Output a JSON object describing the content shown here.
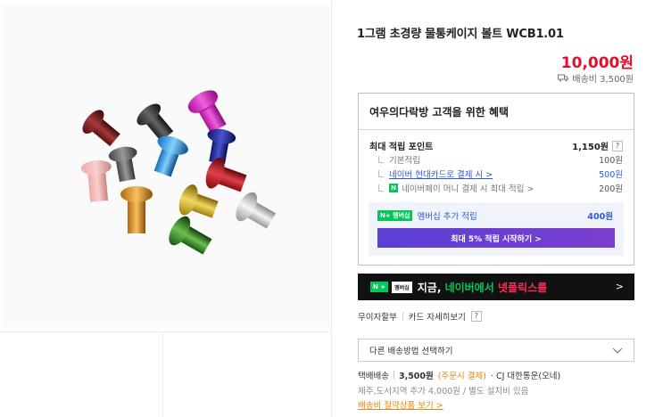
{
  "product": {
    "title": "1그램 초경량 물통케이지 볼트 WCB1.01",
    "price": "10,000원",
    "shipping_fee": "배송비 3,500원"
  },
  "benefits": {
    "title": "여우의다락방 고객을 위한 혜택",
    "max_points_label": "최대 적립 포인트",
    "max_points_value": "1,150원",
    "basic_label": "기본적립",
    "basic_value": "100원",
    "card_label": "네이버 현대카드로 결제 시 >",
    "card_value": "500원",
    "npay_label": "네이버페이 머니 결제 시 최대 적립 >",
    "npay_value": "200원",
    "member_badge": "N+ 멤버십",
    "member_label": "멤버십 추가 적립",
    "member_value": "400원",
    "member_button": "최대 5% 적립 시작하기 >"
  },
  "banner": {
    "badge_np": "N +",
    "badge_mem": "멤버십",
    "text_white": "지금, ",
    "text_green": "네이버에서 ",
    "text_red": "넷플릭스를",
    "chevron": ">"
  },
  "card_info": {
    "interest_free": "무이자할부",
    "card_detail": "카드 자세히보기",
    "help": "?"
  },
  "shipping_select": {
    "label": "다른 배송방법 선택하기",
    "icon": "chevron-down-icon"
  },
  "delivery": {
    "type": "택배배송",
    "price": "3,500원",
    "payment_note": "(주문시 결제)",
    "carrier": "· CJ 대한통운(오네)",
    "extra": "제주,도서지역 추가 4,000원 / 별도 설치비 있음",
    "saving_link": "배송비 절약상품 보기 >"
  },
  "colors": {
    "price_red": "#e0102b",
    "link_blue": "#2c5bd6",
    "naver_green": "#03c75a",
    "purple": "#6a3fd3",
    "orange": "#e8860e"
  }
}
